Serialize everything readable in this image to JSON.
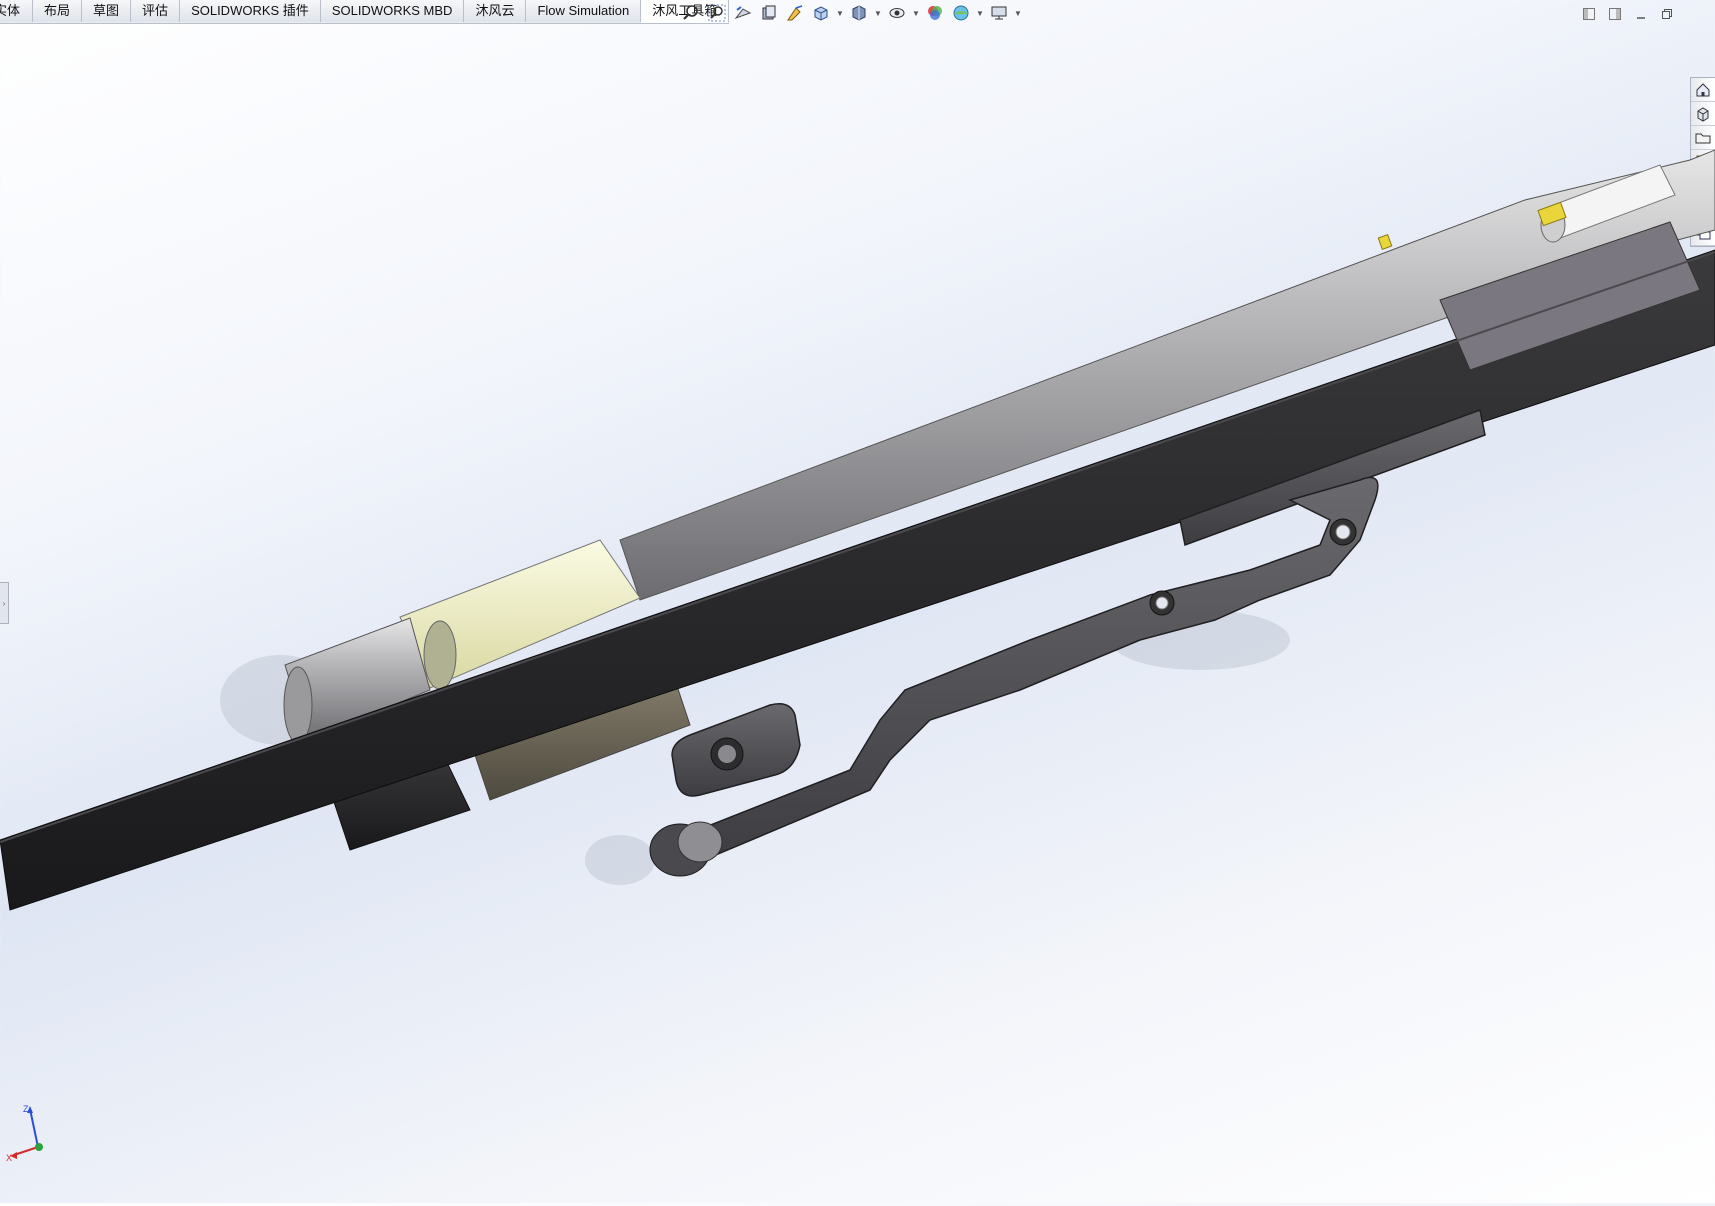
{
  "tabs": [
    {
      "label": "实体"
    },
    {
      "label": "布局"
    },
    {
      "label": "草图"
    },
    {
      "label": "评估"
    },
    {
      "label": "SOLIDWORKS 插件"
    },
    {
      "label": "SOLIDWORKS MBD"
    },
    {
      "label": "沐风云"
    },
    {
      "label": "Flow Simulation"
    },
    {
      "label": "沐风工具箱"
    }
  ],
  "active_tab_index": 8,
  "hud_icons": [
    "zoom-to-fit-icon",
    "zoom-to-area-icon",
    "previous-view-icon",
    "section-view-icon",
    "dynamic-annotation-icon",
    "view-orientation-icon",
    "display-style-icon",
    "hide-show-icon",
    "edit-appearance-icon",
    "apply-scene-icon",
    "view-settings-icon"
  ],
  "task_pane_icons": [
    "home-icon",
    "resources-icon",
    "design-library-icon",
    "file-explorer-icon",
    "appearances-icon",
    "custom-properties-icon",
    "forum-icon"
  ],
  "triad": {
    "x_label": "X",
    "y_label": "Y",
    "z_label": "Z"
  },
  "colors": {
    "tab_active": "#ffffff",
    "body_dark": "#2b2b2d",
    "metal_grey": "#8e8e92",
    "bushing_yellow": "#f3f2c7"
  }
}
